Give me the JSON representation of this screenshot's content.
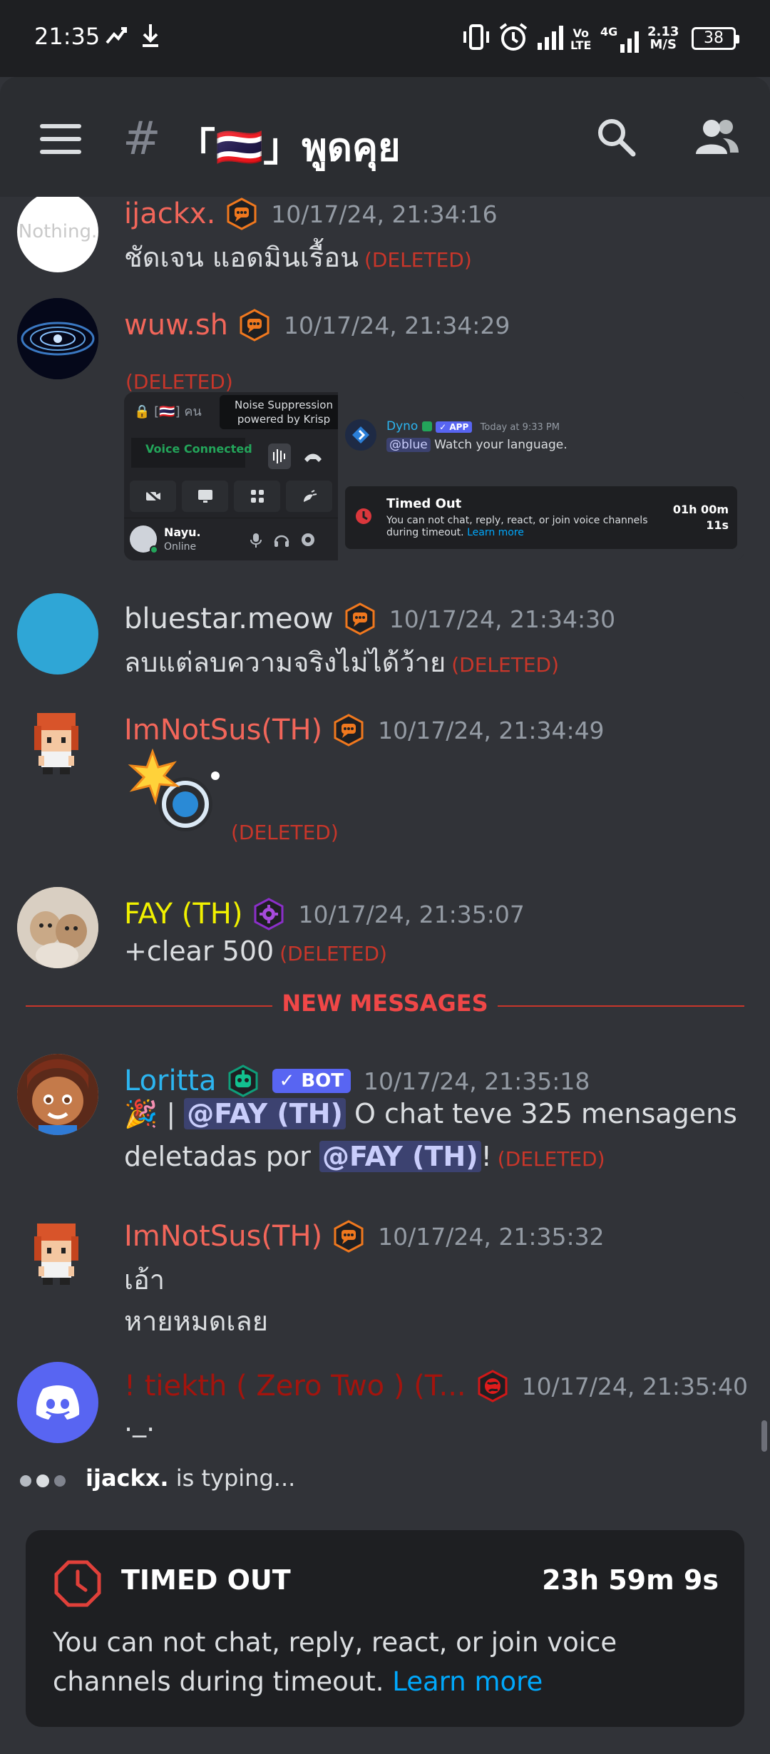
{
  "status_bar": {
    "time": "21:35",
    "network_type_top": "Vo",
    "network_type_bottom": "LTE",
    "data_gen": "4G",
    "speed_value": "2.13",
    "speed_unit": "M/S",
    "battery": "38"
  },
  "header": {
    "channel_hash": "#",
    "channel_name": "「🇹🇭」พูดคุย"
  },
  "messages": [
    {
      "username": "ijackx.",
      "name_color": "#f2665a",
      "timestamp": "10/17/24, 21:34:16",
      "text": "ชัดเจน แอดมินเรื้อน",
      "deleted": "(DELETED)",
      "avatar_text": "Nothing."
    },
    {
      "username": "wuw.sh",
      "name_color": "#f2665a",
      "timestamp": "10/17/24, 21:34:29",
      "deleted": "(DELETED)",
      "attachment": {
        "channel_label": "[🇹🇭] คน",
        "noise_title": "Noise Suppression",
        "noise_sub": "powered by Krisp",
        "voice_status": "Voice Connected",
        "user_name": "Nayu.",
        "user_status": "Online",
        "bot_name": "Dyno",
        "app_badge": "✓ APP",
        "bot_time": "Today at 9:33 PM",
        "bot_mention": "@blue",
        "bot_message": "Watch your language.",
        "timeout_title": "Timed Out",
        "timeout_desc": "You can not chat, reply, react, or join voice channels during timeout.",
        "timeout_link": "Learn more",
        "timeout_time_1": "01h 00m",
        "timeout_time_2": "11s"
      }
    },
    {
      "username": "bluestar.meow",
      "name_color": "#dbdee1",
      "timestamp": "10/17/24, 21:34:30",
      "text": "ลบแต่ลบความจริงไม่ได้ว้าย",
      "deleted": "(DELETED)"
    },
    {
      "username": "ImNotSus(TH)",
      "name_color": "#f2665a",
      "timestamp": "10/17/24, 21:34:49",
      "deleted": "(DELETED)"
    },
    {
      "username": "FAY (TH)",
      "name_color": "#f0f000",
      "timestamp": "10/17/24, 21:35:07",
      "text": "+clear 500",
      "deleted": "(DELETED)"
    },
    {
      "username": "Loritta",
      "name_color": "#2cb5f0",
      "bot_tag": "✓ BOT",
      "timestamp": "10/17/24, 21:35:18",
      "line1_emoji": "🎉",
      "line1_sep": " | ",
      "mention": "@FAY (TH)",
      "line1_text": " O chat teve 325 mensagens",
      "line2_text": "deletadas por ",
      "line2_end": "!",
      "deleted": "(DELETED)"
    },
    {
      "username": "ImNotSus(TH)",
      "name_color": "#f2665a",
      "timestamp": "10/17/24, 21:35:32",
      "text_line1": "เอ้า",
      "text_line2": "หายหมดเลย"
    },
    {
      "username": "! tiekth ( Zero Two ) (T...",
      "name_color": "#a3140d",
      "timestamp": "10/17/24, 21:35:40",
      "text": "._."
    }
  ],
  "divider_label": "NEW MESSAGES",
  "typing": {
    "user": "ijackx.",
    "text": " is typing..."
  },
  "timeout_card": {
    "title": "TIMED OUT",
    "timer": "23h 59m 9s",
    "desc": "You can not chat, reply, react, or join voice channels during timeout.",
    "link": "Learn more"
  },
  "colors": {
    "bg": "#313338",
    "header_bg": "#2b2d31",
    "deleted": "#c8362a",
    "blurple": "#5865f2",
    "link": "#00a8fc"
  }
}
